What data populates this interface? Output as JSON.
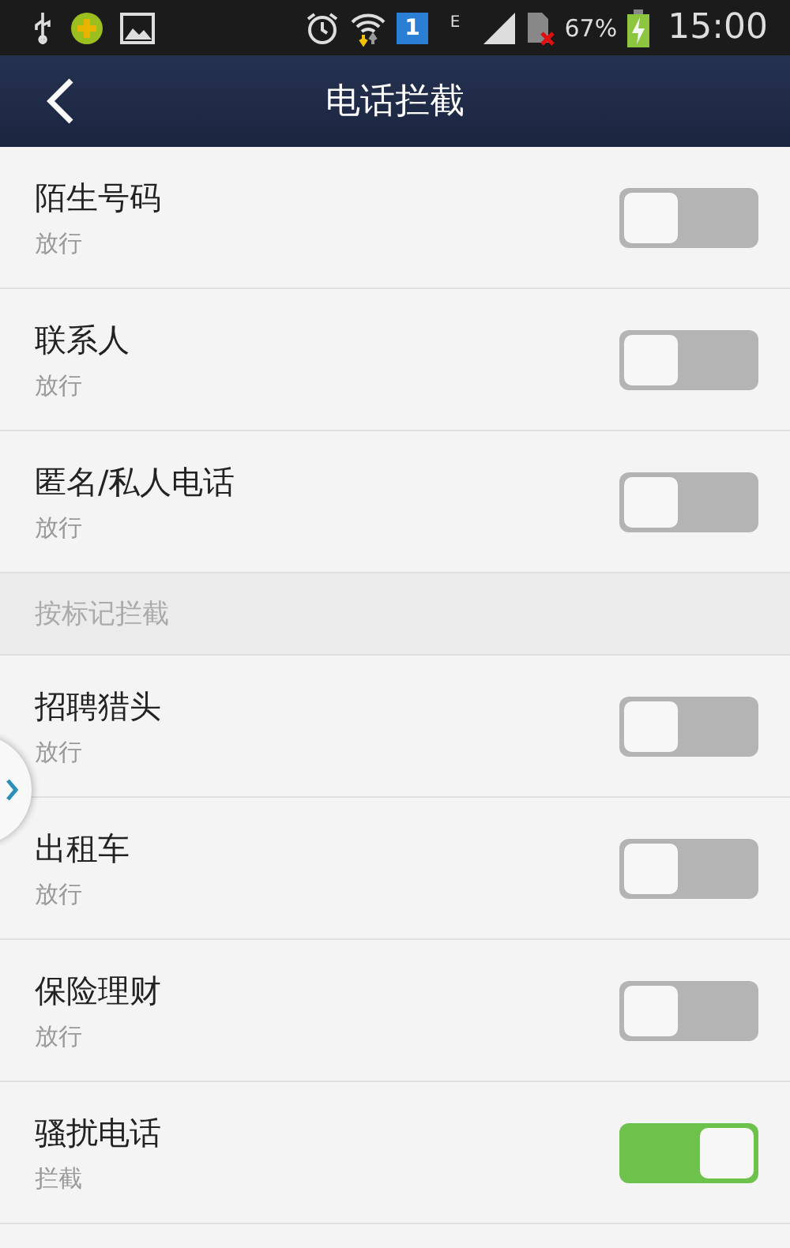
{
  "status_bar": {
    "network_type": "E",
    "sim_number": "1",
    "battery": "67%",
    "time": "15:00"
  },
  "header": {
    "title": "电话拦截"
  },
  "items": [
    {
      "kind": "toggle",
      "title": "陌生号码",
      "subtitle": "放行",
      "on": false
    },
    {
      "kind": "toggle",
      "title": "联系人",
      "subtitle": "放行",
      "on": false
    },
    {
      "kind": "toggle",
      "title": "匿名/私人电话",
      "subtitle": "放行",
      "on": false
    },
    {
      "kind": "section",
      "title": "按标记拦截"
    },
    {
      "kind": "toggle",
      "title": "招聘猎头",
      "subtitle": "放行",
      "on": false
    },
    {
      "kind": "toggle",
      "title": "出租车",
      "subtitle": "放行",
      "on": false
    },
    {
      "kind": "toggle",
      "title": "保险理财",
      "subtitle": "放行",
      "on": false
    },
    {
      "kind": "toggle",
      "title": "骚扰电话",
      "subtitle": "拦截",
      "on": true
    }
  ]
}
